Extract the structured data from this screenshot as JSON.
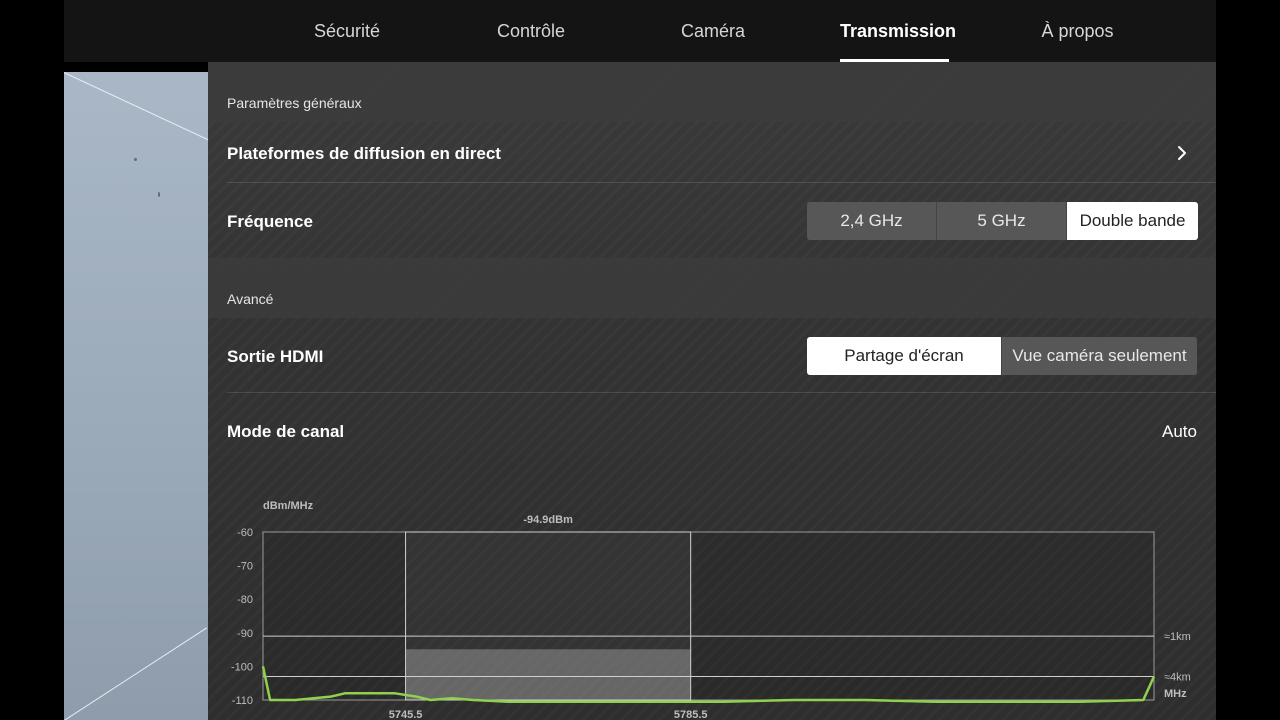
{
  "tabs": [
    {
      "label": "Sécurité",
      "active": false
    },
    {
      "label": "Contrôle",
      "active": false
    },
    {
      "label": "Caméra",
      "active": false
    },
    {
      "label": "Transmission",
      "active": true
    },
    {
      "label": "À propos",
      "active": false
    }
  ],
  "general": {
    "header": "Paramètres généraux",
    "live_platforms_label": "Plateformes de diffusion en direct",
    "frequency_label": "Fréquence",
    "frequency_options": [
      "2,4 GHz",
      "5 GHz",
      "Double bande"
    ],
    "frequency_selected": "Double bande"
  },
  "advanced": {
    "header": "Avancé",
    "hdmi_label": "Sortie HDMI",
    "hdmi_options": [
      "Partage d'écran",
      "Vue caméra seulement"
    ],
    "hdmi_selected": "Partage d'écran",
    "channel_mode_label": "Mode de canal",
    "channel_mode_value": "Auto"
  },
  "colors": {
    "accent_green": "#8fd14f",
    "selected_bg": "#ffffff"
  },
  "chart_data": {
    "type": "line",
    "ylabel": "dBm/MHz",
    "xlabel": "MHz",
    "ylim": [
      -110,
      -60
    ],
    "yticks": [
      -60,
      -70,
      -80,
      -90,
      -100,
      -110
    ],
    "x_tick_labels": [
      "5745.5",
      "5785.5"
    ],
    "xlim": [
      5725.5,
      5850.5
    ],
    "selected_channel": {
      "x_start": 5745.5,
      "x_end": 5785.5,
      "level": -94.9,
      "label": "-94.9dBm"
    },
    "reference_lines": [
      {
        "y": -91,
        "label": "≈1km"
      },
      {
        "y": -103,
        "label": "≈4km"
      }
    ],
    "series": [
      {
        "x": [
          5725.5,
          5726.5,
          5730,
          5735,
          5737,
          5740,
          5744,
          5747,
          5749,
          5752,
          5755,
          5760,
          5770,
          5790,
          5800,
          5810,
          5820,
          5830,
          5840,
          5849,
          5850.5
        ],
        "y": [
          -100,
          -110,
          -110,
          -109,
          -108,
          -108,
          -108,
          -109,
          -110,
          -109.5,
          -110,
          -110.5,
          -110.5,
          -110.5,
          -110,
          -110,
          -110.5,
          -110.5,
          -110.5,
          -110,
          -103
        ]
      }
    ]
  }
}
